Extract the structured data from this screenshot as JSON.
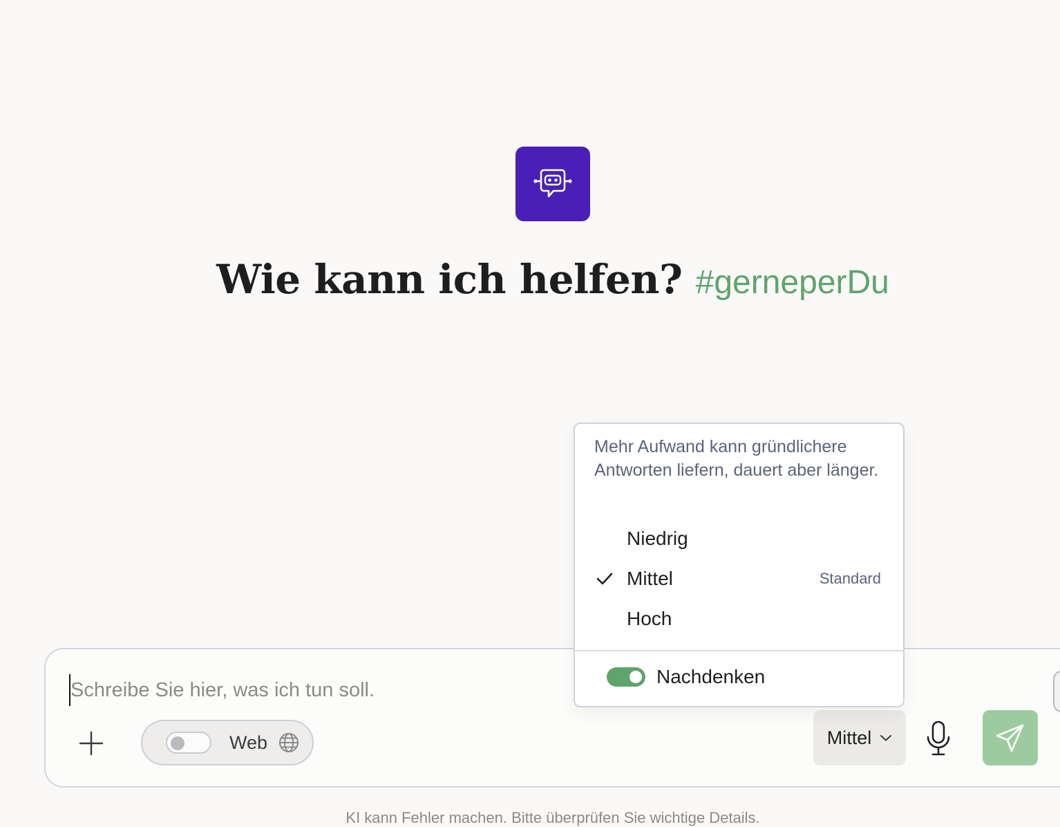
{
  "app": {
    "logo_icon": "chat-robot-icon",
    "brand_color": "#4a1fb8",
    "accent_color": "#5fa46b"
  },
  "headline": {
    "title": "Wie kann ich helfen?",
    "tag": "#gerneperDu"
  },
  "composer": {
    "placeholder": "Schreibe Sie hier, was ich tun soll.",
    "value": "",
    "add_icon": "plus-icon",
    "web_toggle": {
      "label": "Web",
      "enabled": false,
      "icon": "globe-icon"
    },
    "effort_button": {
      "label": "Mittel",
      "icon": "chevron-down-icon"
    },
    "mic_icon": "microphone-icon",
    "send_icon": "paper-plane-icon"
  },
  "effort_menu": {
    "description": "Mehr Aufwand kann gründlichere Antworten liefern, dauert aber länger.",
    "options": [
      {
        "label": "Niedrig",
        "selected": false,
        "note": ""
      },
      {
        "label": "Mittel",
        "selected": true,
        "note": "Standard"
      },
      {
        "label": "Hoch",
        "selected": false,
        "note": ""
      }
    ],
    "thinking": {
      "label": "Nachdenken",
      "enabled": true
    }
  },
  "footer": {
    "note": "KI kann Fehler machen. Bitte überprüfen Sie wichtige Details."
  }
}
